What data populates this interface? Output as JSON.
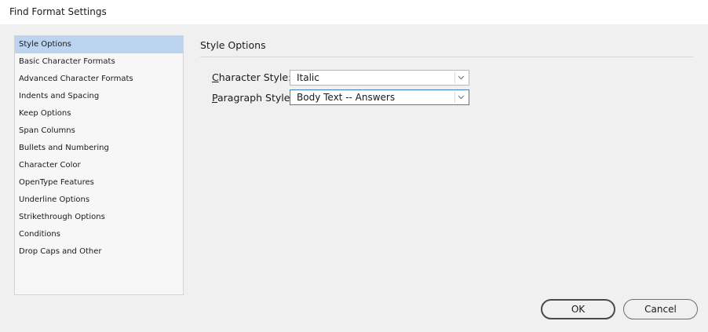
{
  "window": {
    "title": "Find Format Settings"
  },
  "sidebar": {
    "items": [
      {
        "label": "Style Options",
        "selected": true
      },
      {
        "label": "Basic Character Formats"
      },
      {
        "label": "Advanced Character Formats"
      },
      {
        "label": "Indents and Spacing"
      },
      {
        "label": "Keep Options"
      },
      {
        "label": "Span Columns"
      },
      {
        "label": "Bullets and Numbering"
      },
      {
        "label": "Character Color"
      },
      {
        "label": "OpenType Features"
      },
      {
        "label": "Underline Options"
      },
      {
        "label": "Strikethrough Options"
      },
      {
        "label": "Conditions"
      },
      {
        "label": "Drop Caps and Other"
      }
    ]
  },
  "main": {
    "section_title": "Style Options",
    "character_style": {
      "label_accel": "C",
      "label_rest": "haracter Style:",
      "value": "Italic"
    },
    "paragraph_style": {
      "label_accel": "P",
      "label_rest": "aragraph Style:",
      "value": "Body Text -- Answers"
    }
  },
  "buttons": {
    "ok": "OK",
    "cancel": "Cancel"
  },
  "colors": {
    "selection": "#bcd4ef",
    "focus_border": "#3c7fc6"
  },
  "icons": {
    "dropdown": "chevron-down-icon"
  }
}
